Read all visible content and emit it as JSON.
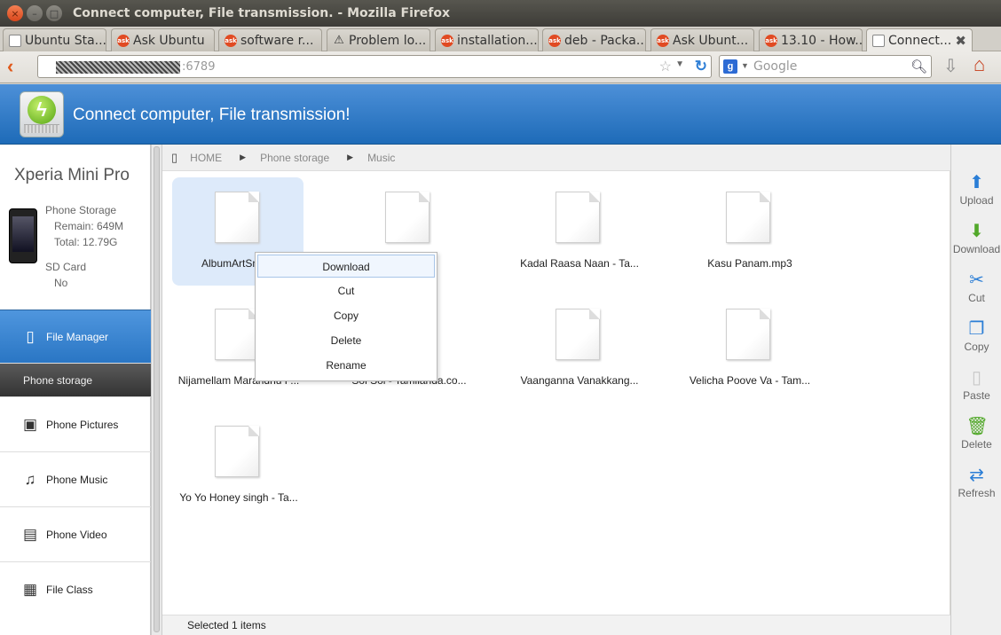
{
  "window": {
    "title": "Connect computer, File transmission. - Mozilla Firefox"
  },
  "tabs": [
    {
      "label": "Ubuntu Sta...",
      "icon": "page-icon"
    },
    {
      "label": "Ask Ubuntu",
      "icon": "askubuntu-icon"
    },
    {
      "label": "software r...",
      "icon": "askubuntu-icon"
    },
    {
      "label": "Problem lo...",
      "icon": "warning-icon"
    },
    {
      "label": "installation...",
      "icon": "askubuntu-icon"
    },
    {
      "label": "deb - Packa...",
      "icon": "askubuntu-icon"
    },
    {
      "label": "Ask Ubunt...",
      "icon": "askubuntu-icon"
    },
    {
      "label": "13.10 - How...",
      "icon": "askubuntu-icon"
    },
    {
      "label": "Connect...",
      "icon": "page-icon",
      "active": true
    }
  ],
  "nav": {
    "url": ":6789",
    "search_placeholder": "Google"
  },
  "app": {
    "title": "Connect computer, File transmission!"
  },
  "device": {
    "name": "Xperia Mini Pro",
    "phone_storage_label": "Phone Storage",
    "remain": "Remain: 649M",
    "total": "Total: 12.79G",
    "sd_card_label": "SD Card",
    "sd_card_value": "No"
  },
  "sidebar": {
    "file_manager": "File Manager",
    "phone_storage": "Phone storage",
    "phone_pictures": "Phone Pictures",
    "phone_music": "Phone Music",
    "phone_video": "Phone Video",
    "file_class": "File Class"
  },
  "breadcrumb": [
    "HOME",
    "Phone storage",
    "Music"
  ],
  "files": [
    {
      "name": "AlbumArtSma...",
      "selected": true
    },
    {
      "name": ""
    },
    {
      "name": "Kadal Raasa Naan - Ta..."
    },
    {
      "name": "Kasu Panam.mp3"
    },
    {
      "name": "Nijamellam Marandhu P..."
    },
    {
      "name": "Soi Soi - Tamilanda.co..."
    },
    {
      "name": "Vaanganna Vanakkang..."
    },
    {
      "name": "Velicha Poove Va - Tam..."
    },
    {
      "name": "Yo Yo Honey singh - Ta..."
    }
  ],
  "context_menu": [
    "Download",
    "Cut",
    "Copy",
    "Delete",
    "Rename"
  ],
  "status": {
    "text": "Selected 1 items"
  },
  "toolbar": {
    "upload": "Upload",
    "download": "Download",
    "cut": "Cut",
    "copy": "Copy",
    "paste": "Paste",
    "delete": "Delete",
    "refresh": "Refresh"
  },
  "colors": {
    "header_blue": "#2a76c4",
    "selected_item": "#ddeafa",
    "firefox_orange": "#e05a1c"
  }
}
